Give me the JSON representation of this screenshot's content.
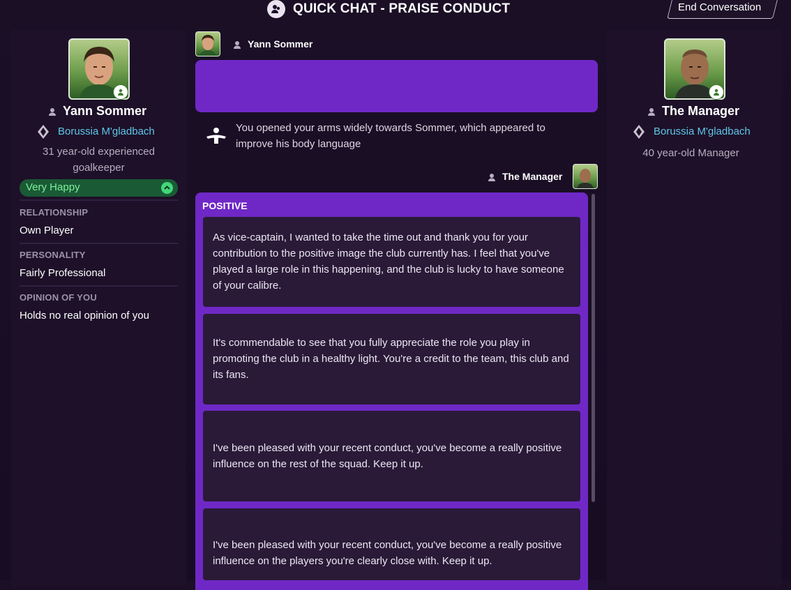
{
  "header": {
    "title": "QUICK CHAT - PRAISE CONDUCT",
    "end_button": "End Conversation"
  },
  "player": {
    "name": "Yann Sommer",
    "club": "Borussia M'gladbach",
    "description": "31 year-old experienced goalkeeper",
    "happiness": "Very Happy",
    "relationship_label": "RELATIONSHIP",
    "relationship_value": "Own Player",
    "personality_label": "PERSONALITY",
    "personality_value": "Fairly Professional",
    "opinion_label": "OPINION OF YOU",
    "opinion_value": "Holds no real opinion of you"
  },
  "manager": {
    "name": "The Manager",
    "club": "Borussia M'gladbach",
    "description": "40 year-old Manager"
  },
  "conversation": {
    "player_speaker": "Yann Sommer",
    "body_language": "You opened your arms widely towards Sommer, which appeared to improve his body language",
    "manager_speaker": "The Manager",
    "options_header": "POSITIVE",
    "options": [
      "As vice-captain, I wanted to take the time out and thank you for your contribution to the positive image the club currently has. I feel that you've played a large role in this happening, and the club is lucky to have someone of your calibre.",
      "It's commendable to see that you fully appreciate the role you play in promoting the club in a healthy light. You're a credit to the team, this club and its fans.",
      "I've been pleased with your recent conduct, you've become a really positive influence on the rest of the squad. Keep it up.",
      "I've been pleased with your recent conduct, you've become a really positive influence on the players you're clearly close with. Keep it up."
    ]
  },
  "colors": {
    "accent_purple": "#6f28c6",
    "club_link": "#5ec6e8",
    "happy_green": "#42d77a"
  }
}
